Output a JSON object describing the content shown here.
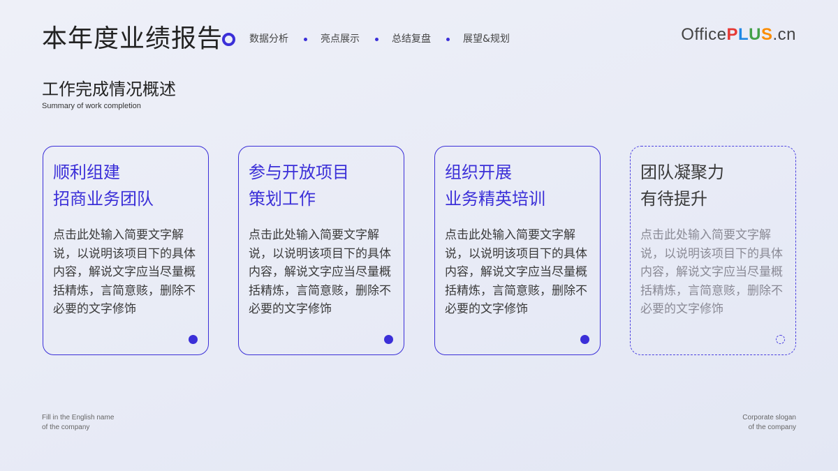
{
  "header": {
    "title": "本年度业绩报告",
    "nav": [
      "数据分析",
      "亮点展示",
      "总结复盘",
      "展望&规划"
    ],
    "logo": {
      "office": "Office",
      "p": "P",
      "l": "L",
      "u": "U",
      "s": "S",
      "cn": ".cn"
    }
  },
  "section": {
    "title": "工作完成情况概述",
    "subtitle": "Summary  of work completion"
  },
  "cards": [
    {
      "title_line1": "顺利组建",
      "title_line2": "招商业务团队",
      "body": "点击此处输入简要文字解说，以说明该项目下的具体内容，解说文字应当尽量概括精炼，言简意赅，删除不必要的文字修饰"
    },
    {
      "title_line1": "参与开放项目",
      "title_line2": "策划工作",
      "body": "点击此处输入简要文字解说，以说明该项目下的具体内容，解说文字应当尽量概括精炼，言简意赅，删除不必要的文字修饰"
    },
    {
      "title_line1": "组织开展",
      "title_line2": "业务精英培训",
      "body": "点击此处输入简要文字解说，以说明该项目下的具体内容，解说文字应当尽量概括精炼，言简意赅，删除不必要的文字修饰"
    },
    {
      "title_line1": "团队凝聚力",
      "title_line2": "有待提升",
      "body": "点击此处输入简要文字解说，以说明该项目下的具体内容，解说文字应当尽量概括精炼，言简意赅，删除不必要的文字修饰"
    }
  ],
  "footer": {
    "left_line1": "Fill in the English name",
    "left_line2": "of the company",
    "right_line1": "Corporate slogan",
    "right_line2": "of the company"
  },
  "colors": {
    "accent": "#3b2fd8",
    "text": "#3a3a3a",
    "muted": "#8a8a95"
  },
  "icons": {
    "nav_active": "ring-icon",
    "nav_separator": "dot-icon",
    "card_marker": "dot-icon",
    "card_marker_hollow": "dashed-circle-icon"
  }
}
